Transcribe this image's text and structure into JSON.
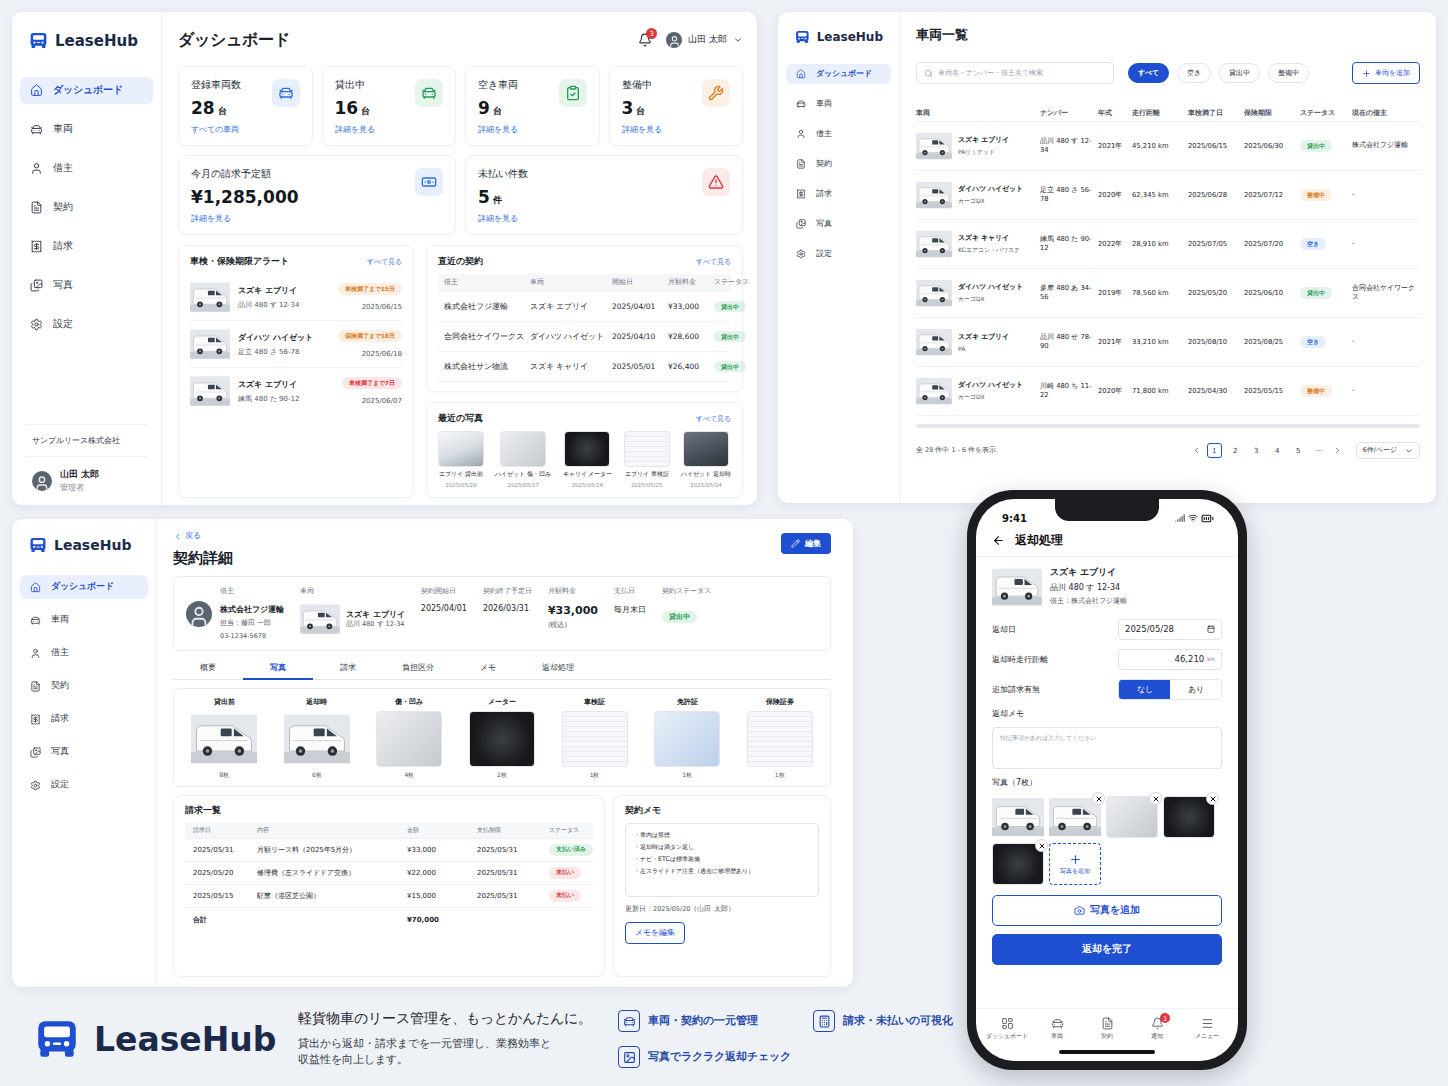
{
  "dashboard": {
    "logo": "LeaseHub",
    "sidebar": {
      "items": [
        {
          "label": "ダッシュボード",
          "selected": true
        },
        {
          "label": "車両",
          "selected": false
        },
        {
          "label": "借主",
          "selected": false
        },
        {
          "label": "契約",
          "selected": false
        },
        {
          "label": "請求",
          "selected": false
        },
        {
          "label": "写真",
          "selected": false
        },
        {
          "label": "設定",
          "selected": false
        }
      ],
      "company": "サンプルリース株式会社",
      "user": {
        "name": "山田 太郎",
        "role": "管理者"
      }
    },
    "header": {
      "title": "ダッシュボード",
      "notifications": "3",
      "user": "山田 太郎"
    },
    "stats": [
      {
        "label": "登録車両数",
        "value": "28",
        "unit": "台",
        "link": "すべての車両",
        "color": "#2f6fe0"
      },
      {
        "label": "貸出中",
        "value": "16",
        "unit": "台",
        "link": "詳細を見る",
        "color": "#1f9d55"
      },
      {
        "label": "空き車両",
        "value": "9",
        "unit": "台",
        "link": "詳細を見る",
        "color": "#1f9d55"
      },
      {
        "label": "整備中",
        "value": "3",
        "unit": "台",
        "link": "詳細を見る",
        "color": "#e07a1f"
      }
    ],
    "billing": [
      {
        "label": "今月の請求予定額",
        "value": "¥1,285,000",
        "link": "詳細を見る",
        "color": "#2f6fe0"
      },
      {
        "label": "未払い件数",
        "value": "5",
        "unit": "件",
        "link": "詳細を見る",
        "color": "#e0363c"
      }
    ],
    "alerts": {
      "title": "車検・保険期限アラート",
      "link": "すべて見る",
      "items": [
        {
          "name": "スズキ エブリイ",
          "plate": "品川 480 す 12-34",
          "badge": "車検満了まで15日",
          "date": "2025/06/15",
          "color": "#e07a1f"
        },
        {
          "name": "ダイハツ ハイゼット",
          "plate": "足立 480 さ 56-78",
          "badge": "保険満了まで18日",
          "date": "2025/06/18",
          "color": "#e07a1f"
        },
        {
          "name": "スズキ エブリイ",
          "plate": "練馬 480 た 90-12",
          "badge": "車検満了まで7日",
          "date": "2025/06/07",
          "color": "#e0363c"
        }
      ]
    },
    "contracts": {
      "title": "直近の契約",
      "link": "すべて見る",
      "columns": [
        "借主",
        "車両",
        "開始日",
        "月額料金",
        "ステータス"
      ],
      "rows": [
        {
          "lessee": "株式会社フジ運輸",
          "vehicle": "スズキ エブリイ",
          "start": "2025/04/01",
          "fee": "¥33,000",
          "status": "貸出中",
          "color": "#1f9d55"
        },
        {
          "lessee": "合同会社ケイワークス",
          "vehicle": "ダイハツ ハイゼット",
          "start": "2025/04/10",
          "fee": "¥28,600",
          "status": "貸出中",
          "color": "#1f9d55"
        },
        {
          "lessee": "株式会社サン物流",
          "vehicle": "スズキ キャリイ",
          "start": "2025/05/01",
          "fee": "¥26,400",
          "status": "貸出中",
          "color": "#1f9d55"
        }
      ]
    },
    "photos": {
      "title": "最近の写真",
      "link": "すべて見る",
      "items": [
        {
          "caption": "エブリイ 貸出前",
          "date": "2025/05/28"
        },
        {
          "caption": "ハイゼット 傷・凹み",
          "date": "2025/05/27"
        },
        {
          "caption": "キャリイ メーター",
          "date": "2025/05/26"
        },
        {
          "caption": "エブリイ 車検証",
          "date": "2025/05/25"
        },
        {
          "caption": "ハイゼット 返却時",
          "date": "2025/05/24"
        }
      ]
    }
  },
  "vehicles": {
    "logo": "LeaseHub",
    "sidebar": {
      "items": [
        {
          "label": "ダッシュボード",
          "selected": true
        },
        {
          "label": "車両",
          "selected": false
        },
        {
          "label": "借主",
          "selected": false
        },
        {
          "label": "契約",
          "selected": false
        },
        {
          "label": "請求",
          "selected": false
        },
        {
          "label": "写真",
          "selected": false
        },
        {
          "label": "設定",
          "selected": false
        }
      ]
    },
    "title": "車両一覧",
    "search": {
      "placeholder": "車両名・ナンバー・借主名で検索"
    },
    "filters": [
      {
        "label": "すべて",
        "selected": true
      },
      {
        "label": "空き",
        "selected": false
      },
      {
        "label": "貸出中",
        "selected": false
      },
      {
        "label": "整備中",
        "selected": false
      }
    ],
    "add_button": "車両を追加",
    "table": {
      "columns": [
        "車両",
        "ナンバー",
        "年式",
        "走行距離",
        "車検満了日",
        "保険期限",
        "ステータス",
        "現在の借主"
      ],
      "rows": [
        {
          "name": "スズキ エブリイ",
          "grade": "PAリミテッド",
          "plate": "品川 480 す 12-34",
          "year": "2021年",
          "mileage": "45,210 km",
          "inspection": "2025/06/15",
          "insurance": "2025/06/30",
          "status": "貸出中",
          "color": "#1f9d55",
          "lessee": "株式会社フジ運輸"
        },
        {
          "name": "ダイハツ ハイゼット",
          "grade": "カーゴDX",
          "plate": "足立 480 さ 56-78",
          "year": "2020年",
          "mileage": "62,345 km",
          "inspection": "2025/06/28",
          "insurance": "2025/07/12",
          "status": "整備中",
          "color": "#e07a1f",
          "lessee": "-"
        },
        {
          "name": "スズキ キャリイ",
          "grade": "KCエアコン・パワステ",
          "plate": "練馬 480 た 90-12",
          "year": "2022年",
          "mileage": "28,910 km",
          "inspection": "2025/07/05",
          "insurance": "2025/07/20",
          "status": "空き",
          "color": "#2f6fe0",
          "lessee": "-"
        },
        {
          "name": "ダイハツ ハイゼット",
          "grade": "カーゴDX",
          "plate": "多摩 480 あ 34-56",
          "year": "2019年",
          "mileage": "78,560 km",
          "inspection": "2025/05/20",
          "insurance": "2025/06/10",
          "status": "貸出中",
          "color": "#1f9d55",
          "lessee": "合同会社ケイワークス"
        },
        {
          "name": "スズキ エブリイ",
          "grade": "PA",
          "plate": "品川 480 せ 78-90",
          "year": "2021年",
          "mileage": "33,210 km",
          "inspection": "2025/08/10",
          "insurance": "2025/08/25",
          "status": "空き",
          "color": "#2f6fe0",
          "lessee": "-"
        },
        {
          "name": "ダイハツ ハイゼット",
          "grade": "カーゴDX",
          "plate": "川崎 480 ち 11-22",
          "year": "2020年",
          "mileage": "71,800 km",
          "inspection": "2025/04/30",
          "insurance": "2025/05/15",
          "status": "整備中",
          "color": "#e07a1f",
          "lessee": "-"
        }
      ]
    },
    "footer": {
      "summary": "全 28 件中 1 - 6 件を表示",
      "pages": [
        {
          "label": "1",
          "selected": true
        },
        {
          "label": "2",
          "selected": false
        },
        {
          "label": "3",
          "selected": false
        },
        {
          "label": "4",
          "selected": false
        },
        {
          "label": "5",
          "selected": false
        },
        {
          "label": "···",
          "selected": false
        }
      ],
      "per_page": "6件/ページ"
    }
  },
  "contract": {
    "logo": "LeaseHub",
    "sidebar": {
      "items": [
        {
          "label": "ダッシュボード",
          "selected": true
        },
        {
          "label": "車両",
          "selected": false
        },
        {
          "label": "借主",
          "selected": false
        },
        {
          "label": "契約",
          "selected": false
        },
        {
          "label": "請求",
          "selected": false
        },
        {
          "label": "写真",
          "selected": false
        },
        {
          "label": "設定",
          "selected": false
        }
      ]
    },
    "back": "戻る",
    "title": "契約詳細",
    "edit": "編集",
    "info": {
      "lessee_label": "借主",
      "lessee": "株式会社フジ運輸",
      "contact": "担当：藤田 一郎",
      "phone": "03-1234-5678",
      "vehicle_label": "車両",
      "vehicle": "スズキ エブリイ",
      "plate": "品川 480 す 12-34",
      "fields": [
        {
          "label": "契約開始日",
          "value": "2025/04/01"
        },
        {
          "label": "契約終了予定日",
          "value": "2026/03/31"
        }
      ],
      "fee_label": "月額料金",
      "fee": "¥33,000",
      "fee_note": "(税込)",
      "pay_label": "支払日",
      "pay": "毎月末日",
      "status_label": "契約ステータス",
      "status": "貸出中",
      "status_color": "#1f9d55"
    },
    "tabs": [
      {
        "label": "概要",
        "selected": false
      },
      {
        "label": "写真",
        "selected": true
      },
      {
        "label": "請求",
        "selected": false
      },
      {
        "label": "負担区分",
        "selected": false
      },
      {
        "label": "メモ",
        "selected": false
      },
      {
        "label": "返却処理",
        "selected": false
      }
    ],
    "photo_groups": [
      {
        "label": "貸出前",
        "count": "8枚"
      },
      {
        "label": "返却時",
        "count": "6枚"
      },
      {
        "label": "傷・凹み",
        "count": "4枚"
      },
      {
        "label": "メーター",
        "count": "2枚"
      },
      {
        "label": "車検証",
        "count": "1枚"
      },
      {
        "label": "免許証",
        "count": "1枚"
      },
      {
        "label": "保険証券",
        "count": "1枚"
      }
    ],
    "billing": {
      "title": "請求一覧",
      "columns": [
        "請求日",
        "内容",
        "金額",
        "支払期限",
        "ステータス"
      ],
      "rows": [
        {
          "date": "2025/05/31",
          "item": "月額リース料（2025年5月分）",
          "amount": "¥33,000",
          "due": "2025/05/31",
          "status": "支払い済み",
          "color": "#1f9d55"
        },
        {
          "date": "2025/05/20",
          "item": "修理費（左スライドドア交換）",
          "amount": "¥22,000",
          "due": "2025/05/31",
          "status": "未払い",
          "color": "#e0363c"
        },
        {
          "date": "2025/05/15",
          "item": "駐禁（港区芝公園）",
          "amount": "¥15,000",
          "due": "2025/05/31",
          "status": "未払い",
          "color": "#e0363c"
        }
      ],
      "total_label": "合計",
      "total": "¥70,000"
    },
    "memo": {
      "title": "契約メモ",
      "lines": [
        "・車内は禁煙",
        "・返却時は満タン返し",
        "・ナビ・ETCは標準装備",
        "・左スライドドア注意（過去に修理歴あり）"
      ],
      "updated": "更新日：2025/05/20（山田 太郎）",
      "button": "メモを編集"
    }
  },
  "mobile": {
    "time": "9:41",
    "title": "返却処理",
    "vehicle": {
      "name": "スズキ エブリイ",
      "plate": "品川 480 す 12-34",
      "lessee": "借主：株式会社フジ運輸"
    },
    "date_label": "返却日",
    "date": "2025/05/28",
    "mileage_label": "返却時走行距離",
    "mileage": "46,210",
    "mileage_unit": "km",
    "extra_label": "追加請求有無",
    "extra_options": [
      {
        "label": "なし",
        "selected": true
      },
      {
        "label": "あり",
        "selected": false
      }
    ],
    "memo_label": "返却メモ",
    "memo_placeholder": "特記事項があれば入力してください",
    "photos_label": "写真（7枚）",
    "photos": [
      {
        "removable": false
      },
      {
        "removable": true
      },
      {
        "removable": true
      },
      {
        "removable": true
      },
      {
        "removable": true
      }
    ],
    "add_tile": "写真を追加",
    "add_button": "写真を追加",
    "complete_button": "返却を完了",
    "nav": [
      {
        "label": "ダッシュボード"
      },
      {
        "label": "車両"
      },
      {
        "label": "契約"
      },
      {
        "label": "通知",
        "badge": "3"
      },
      {
        "label": "メニュー"
      }
    ]
  },
  "branding": {
    "logo": "LeaseHub",
    "tagline": "軽貨物車のリース管理を、もっとかんたんに。",
    "description_lines": [
      "貸出から返却・請求までを一元管理し、業務効率と",
      "収益性を向上します。"
    ],
    "features": [
      "車両・契約の一元管理",
      "請求・未払いの可視化",
      "写真でラクラク返却チェック"
    ]
  }
}
